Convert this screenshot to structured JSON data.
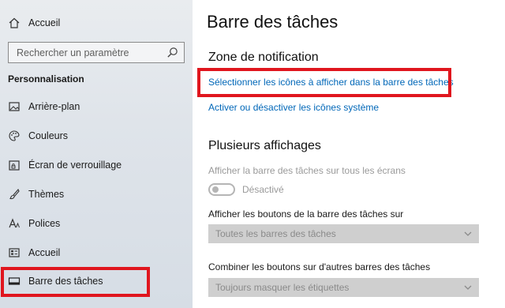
{
  "sidebar": {
    "home_label": "Accueil",
    "search_placeholder": "Rechercher un paramètre",
    "section_title": "Personnalisation",
    "items": [
      {
        "label": "Arrière-plan",
        "icon": "picture-icon"
      },
      {
        "label": "Couleurs",
        "icon": "palette-icon"
      },
      {
        "label": "Écran de verrouillage",
        "icon": "lock-screen-icon"
      },
      {
        "label": "Thèmes",
        "icon": "brush-icon"
      },
      {
        "label": "Polices",
        "icon": "font-icon"
      },
      {
        "label": "Accueil",
        "icon": "start-icon"
      },
      {
        "label": "Barre des tâches",
        "icon": "taskbar-icon"
      }
    ]
  },
  "main": {
    "title": "Barre des tâches",
    "notification": {
      "heading": "Zone de notification",
      "link_icons": "Sélectionner les icônes à afficher dans la barre des tâches",
      "link_system": "Activer ou désactiver les icônes système"
    },
    "multi_display": {
      "heading": "Plusieurs affichages",
      "show_on_all_label": "Afficher la barre des tâches sur tous les écrans",
      "toggle_state": "Désactivé",
      "show_buttons_label": "Afficher les boutons de la barre des tâches sur",
      "show_buttons_value": "Toutes les barres des tâches",
      "combine_label": "Combiner les boutons sur d'autres barres des tâches",
      "combine_value": "Toujours masquer les étiquettes"
    }
  },
  "colors": {
    "accent_link": "#0067b8",
    "highlight": "#e0161e"
  }
}
